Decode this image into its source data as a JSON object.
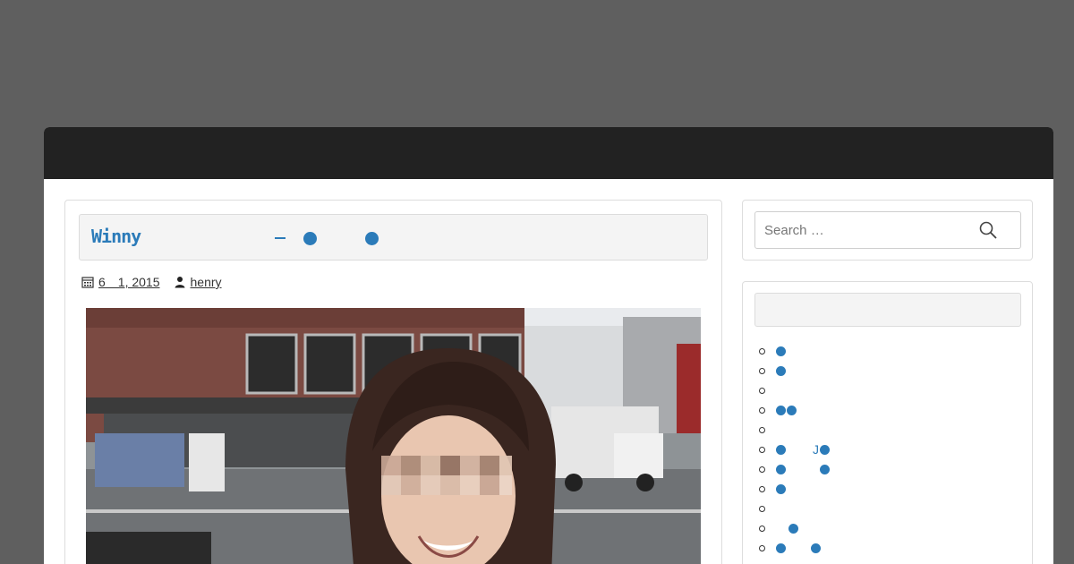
{
  "post": {
    "title": "Winny",
    "date": "6　1, 2015",
    "author": "henry"
  },
  "search": {
    "placeholder": "Search …"
  },
  "sidebar": {
    "widget_title": "",
    "items": [
      {
        "label": ""
      },
      {
        "label": ""
      },
      {
        "label": ""
      },
      {
        "label": ""
      },
      {
        "label": ""
      },
      {
        "label": "J"
      },
      {
        "label": ""
      },
      {
        "label": ""
      },
      {
        "label": ""
      },
      {
        "label": ""
      },
      {
        "label": ""
      }
    ]
  },
  "colors": {
    "accent": "#2b7bb9",
    "header": "#222222",
    "backdrop": "#5f5f5f"
  },
  "icons": {
    "date": "calendar-icon",
    "author": "user-icon",
    "search": "search-icon"
  }
}
